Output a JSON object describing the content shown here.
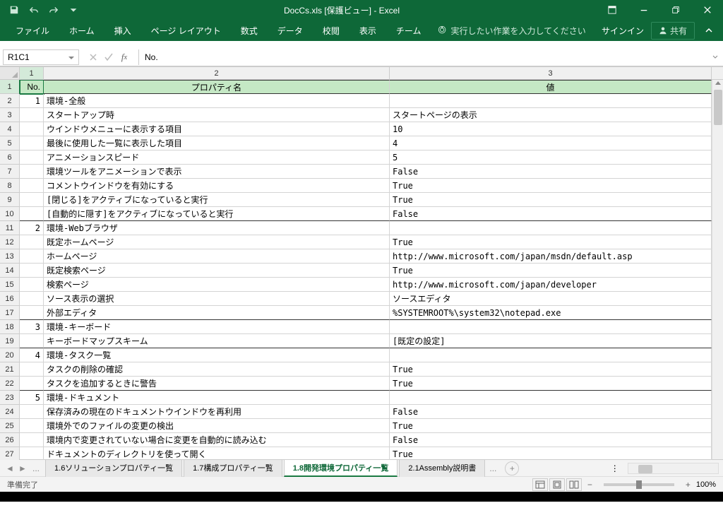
{
  "title": "DocCs.xls  [保護ビュー] - Excel",
  "qat": {
    "save": "save",
    "undo": "undo",
    "redo": "redo",
    "customize": "customize"
  },
  "window_controls": {
    "ribbon_options": "ribbon-display",
    "minimize": "minimize",
    "restore": "restore",
    "close": "close"
  },
  "ribbon": {
    "tabs": [
      "ファイル",
      "ホーム",
      "挿入",
      "ページ レイアウト",
      "数式",
      "データ",
      "校閲",
      "表示",
      "チーム"
    ],
    "tell_me": "実行したい作業を入力してください",
    "signin": "サインイン",
    "share": "共有"
  },
  "formula_bar": {
    "name_box": "R1C1",
    "formula": "No."
  },
  "columns": [
    "1",
    "2",
    "3"
  ],
  "headers": {
    "c1": "No.",
    "c2": "プロパティ名",
    "c3": "値"
  },
  "rows": [
    {
      "r": 1,
      "no": "",
      "name": "",
      "val": "",
      "header": true
    },
    {
      "r": 2,
      "no": "1",
      "name": "環境-全般",
      "val": ""
    },
    {
      "r": 3,
      "no": "",
      "name": "スタートアップ時",
      "val": "スタートページの表示"
    },
    {
      "r": 4,
      "no": "",
      "name": "ウインドウメニューに表示する項目",
      "val": "10"
    },
    {
      "r": 5,
      "no": "",
      "name": "最後に使用した一覧に表示した項目",
      "val": "4"
    },
    {
      "r": 6,
      "no": "",
      "name": "アニメーションスピード",
      "val": "5"
    },
    {
      "r": 7,
      "no": "",
      "name": "環境ツールをアニメーションで表示",
      "val": "False"
    },
    {
      "r": 8,
      "no": "",
      "name": "コメントウインドウを有効にする",
      "val": "True"
    },
    {
      "r": 9,
      "no": "",
      "name": "[閉じる]をアクティブになっていると実行",
      "val": "True"
    },
    {
      "r": 10,
      "no": "",
      "name": "[自動的に隠す]をアクティブになっていると実行",
      "val": "False",
      "underline": true
    },
    {
      "r": 11,
      "no": "2",
      "name": "環境-Webブラウザ",
      "val": ""
    },
    {
      "r": 12,
      "no": "",
      "name": "既定ホームページ",
      "val": "True"
    },
    {
      "r": 13,
      "no": "",
      "name": "ホームページ",
      "val": "http://www.microsoft.com/japan/msdn/default.asp"
    },
    {
      "r": 14,
      "no": "",
      "name": "既定検索ページ",
      "val": "True"
    },
    {
      "r": 15,
      "no": "",
      "name": "検索ページ",
      "val": "http://www.microsoft.com/japan/developer"
    },
    {
      "r": 16,
      "no": "",
      "name": "ソース表示の選択",
      "val": "ソースエディタ"
    },
    {
      "r": 17,
      "no": "",
      "name": "外部エディタ",
      "val": "%SYSTEMROOT%\\system32\\notepad.exe",
      "underline": true
    },
    {
      "r": 18,
      "no": "3",
      "name": "環境-キーボード",
      "val": ""
    },
    {
      "r": 19,
      "no": "",
      "name": "キーボードマップスキーム",
      "val": "[既定の設定]",
      "underline": true
    },
    {
      "r": 20,
      "no": "4",
      "name": "環境-タスク一覧",
      "val": ""
    },
    {
      "r": 21,
      "no": "",
      "name": "タスクの削除の確認",
      "val": "True"
    },
    {
      "r": 22,
      "no": "",
      "name": "タスクを追加するときに警告",
      "val": "True",
      "underline": true
    },
    {
      "r": 23,
      "no": "5",
      "name": "環境-ドキュメント",
      "val": ""
    },
    {
      "r": 24,
      "no": "",
      "name": "保存済みの現在のドキュメントウインドウを再利用",
      "val": "False"
    },
    {
      "r": 25,
      "no": "",
      "name": "環境外でのファイルの変更の検出",
      "val": "True"
    },
    {
      "r": 26,
      "no": "",
      "name": "環境内で変更されていない場合に変更を自動的に読み込む",
      "val": "False"
    },
    {
      "r": 27,
      "no": "",
      "name": "ドキュメントのディレクトリを使って開く",
      "val": "True"
    }
  ],
  "sheet_tabs": {
    "tabs": [
      {
        "label": "1.6ソリューションプロパティ一覧",
        "active": false
      },
      {
        "label": "1.7構成プロパティ一覧",
        "active": false
      },
      {
        "label": "1.8開発環境プロパティ一覧",
        "active": true
      },
      {
        "label": "2.1Assembly説明書",
        "active": false
      }
    ],
    "overflow_left": "...",
    "overflow_right": "..."
  },
  "status": {
    "text": "準備完了",
    "zoom": "100%"
  }
}
